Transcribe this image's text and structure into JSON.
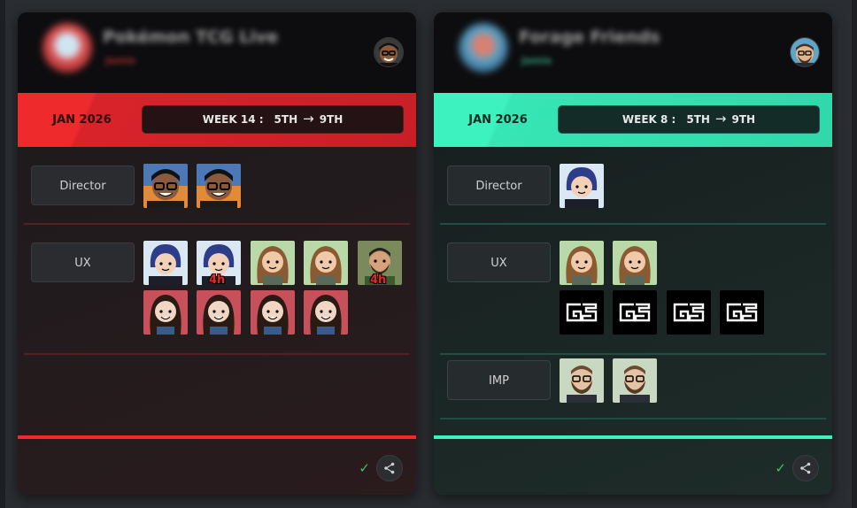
{
  "colors": {
    "left_accent": "#ee2a2d",
    "right_accent": "#3df2bf",
    "ok_check": "#3fbf72"
  },
  "cards": [
    {
      "team_name": "Pokémon TCG Live",
      "team_sub": "Jamie",
      "month": "JAN 2026",
      "week_label": "WEEK 14 :",
      "range_start": "5TH",
      "arrow": "→",
      "range_end": "9TH",
      "status_icon": "✓",
      "roles": [
        {
          "label": "Director",
          "members": [
            "director-avatar-man-glasses",
            "director-avatar-man-glasses"
          ]
        },
        {
          "label": "UX",
          "members": [
            "blue-hair-avatar",
            "blue-hair-avatar",
            "long-brown-hair-avatar",
            "long-brown-hair-avatar",
            "bearded-man-avatar",
            "dark-hair-woman-avatar",
            "dark-hair-woman-avatar",
            "dark-hair-woman-avatar",
            "dark-hair-woman-avatar"
          ],
          "badges": {
            "1": "4h",
            "4": "4h"
          }
        }
      ]
    },
    {
      "team_name": "Forage Friends",
      "team_sub": "Jamie",
      "month": "JAN 2026",
      "week_label": "WEEK 8 :",
      "range_start": "5TH",
      "arrow": "→",
      "range_end": "9TH",
      "status_icon": "✓",
      "roles": [
        {
          "label": "Director",
          "members": [
            "blue-hair-avatar"
          ]
        },
        {
          "label": "UX",
          "members": [
            "long-brown-hair-avatar",
            "long-brown-hair-avatar",
            "gs-logo",
            "gs-logo",
            "gs-logo",
            "gs-logo"
          ]
        },
        {
          "label": "IMP",
          "members": [
            "bearded-glasses-avatar",
            "bearded-glasses-avatar"
          ]
        }
      ]
    }
  ]
}
